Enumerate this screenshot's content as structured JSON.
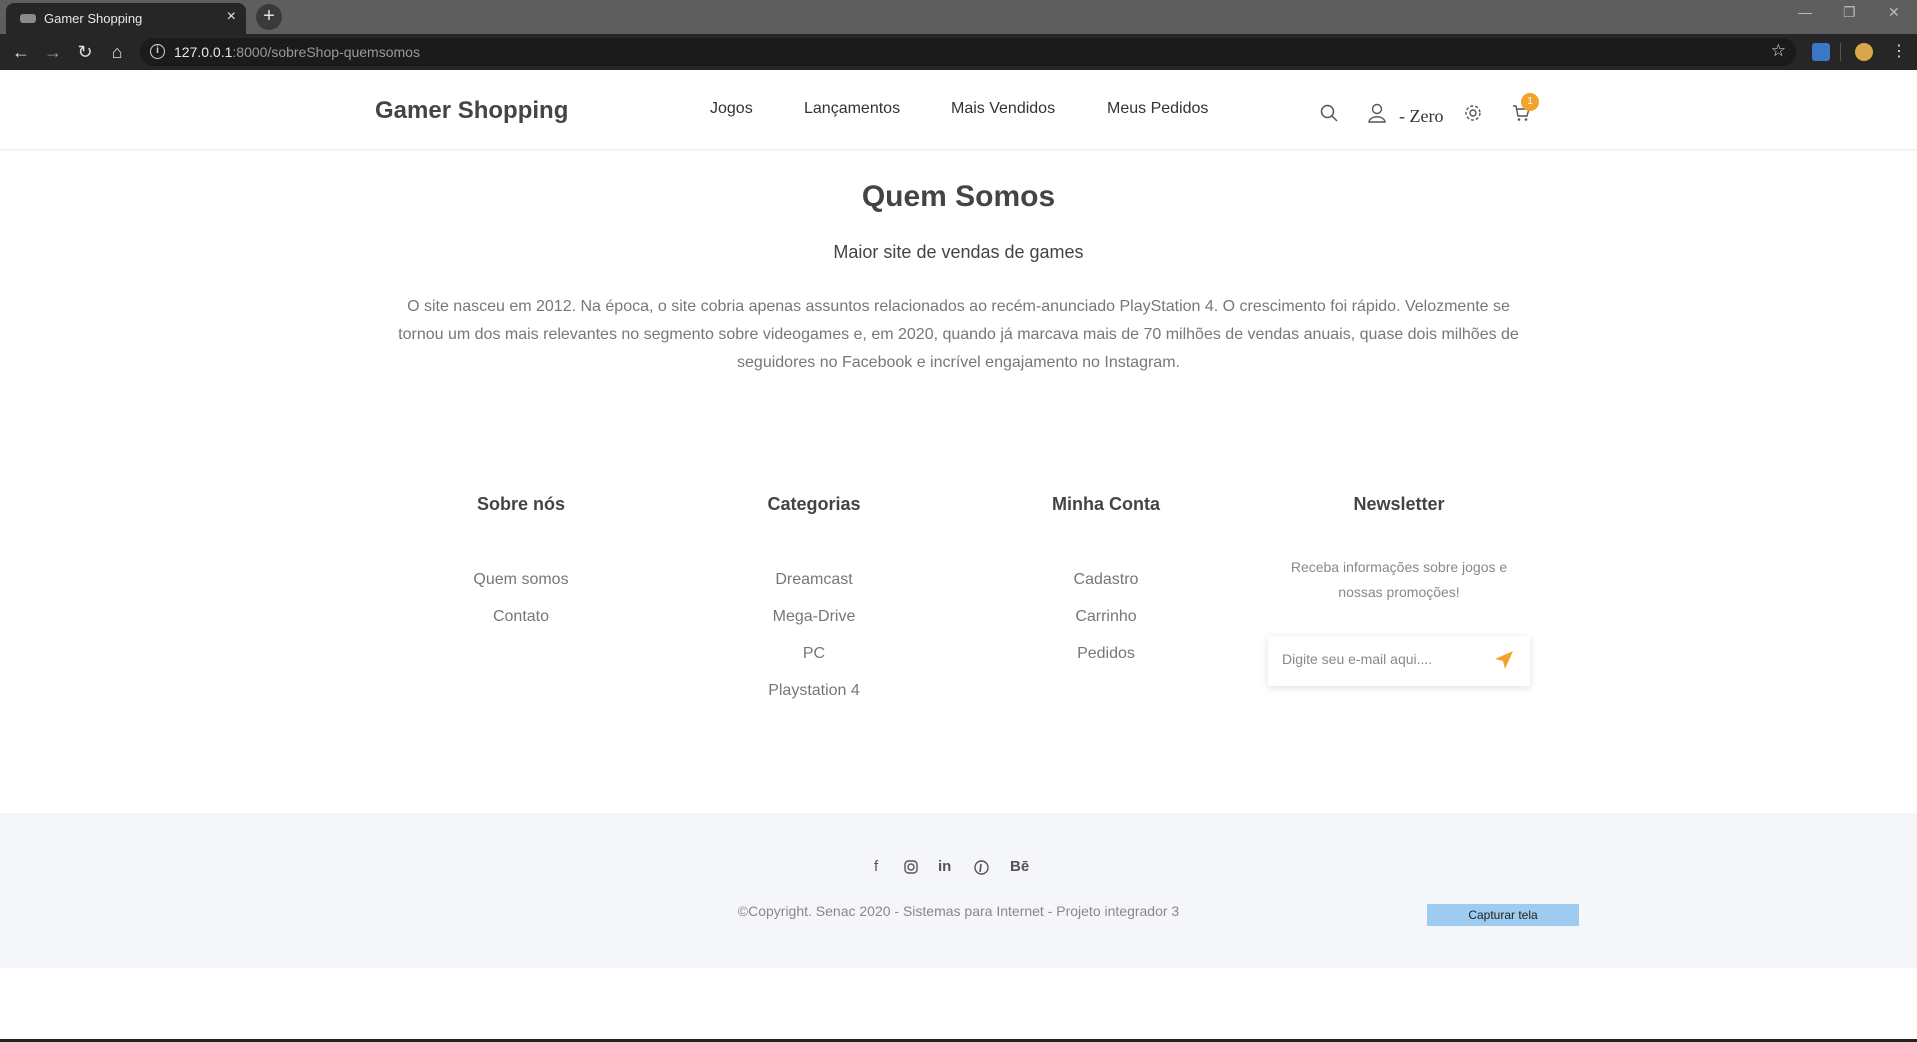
{
  "browser": {
    "tab_title": "Gamer Shopping",
    "tab_close": "×",
    "new_tab": "+",
    "url_host": "127.0.0.1",
    "url_rest": ":8000/sobreShop-quemsomos"
  },
  "header": {
    "brand": "Gamer Shopping",
    "menu": [
      "Jogos",
      "Lançamentos",
      "Mais Vendidos",
      "Meus Pedidos"
    ],
    "user_label": "- Zero",
    "cart_count": "1"
  },
  "main": {
    "title": "Quem Somos",
    "subtitle": "Maior site de vendas de games",
    "text": "O site nasceu em 2012. Na época, o site cobria apenas assuntos relacionados ao recém-anunciado PlayStation 4. O crescimento foi rápido. Velozmente se tornou um dos mais relevantes no segmento sobre videogames e, em 2020, quando já marcava mais de 70 milhões de vendas anuais, quase dois milhões de seguidores no Facebook e incrível engajamento no Instagram."
  },
  "footer": {
    "sobre": {
      "title": "Sobre nós",
      "links": [
        "Quem somos",
        "Contato"
      ]
    },
    "categorias": {
      "title": "Categorias",
      "links": [
        "Dreamcast",
        "Mega-Drive",
        "PC",
        "Playstation 4"
      ]
    },
    "conta": {
      "title": "Minha Conta",
      "links": [
        "Cadastro",
        "Carrinho",
        "Pedidos"
      ]
    },
    "newsletter": {
      "title": "Newsletter",
      "text": "Receba informações sobre jogos e nossas promoções!",
      "placeholder": "Digite seu e-mail aqui...."
    },
    "socials": [
      "facebook-icon",
      "instagram-icon",
      "linkedin-icon",
      "pinterest-icon",
      "behance-icon"
    ],
    "copyright": "©Copyright. Senac 2020 - Sistemas para Internet - Projeto integrador 3",
    "capture_label": "Capturar tela"
  }
}
